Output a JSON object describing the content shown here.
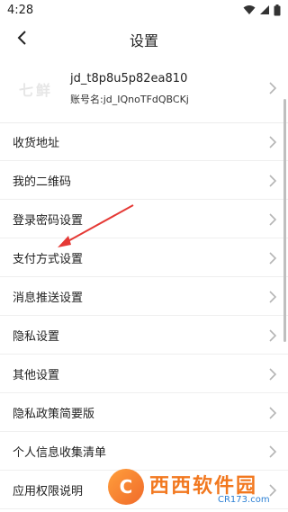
{
  "status": {
    "time": "4:28"
  },
  "header": {
    "title": "设置"
  },
  "account": {
    "logo_text": "七鲜",
    "username": "jd_t8p8u5p82ea810",
    "account_id": "账号名:jd_IQnoTFdQBCKj"
  },
  "menu": [
    {
      "label": "收货地址"
    },
    {
      "label": "我的二维码"
    },
    {
      "label": "登录密码设置"
    },
    {
      "label": "支付方式设置"
    },
    {
      "label": "消息推送设置"
    },
    {
      "label": "隐私设置"
    },
    {
      "label": "其他设置"
    },
    {
      "label": "隐私政策简要版"
    },
    {
      "label": "个人信息收集清单"
    },
    {
      "label": "应用权限说明"
    }
  ],
  "watermark": {
    "main": "西西软件园",
    "sub": "CR173.com"
  },
  "colors": {
    "annotation_arrow": "#e53935",
    "watermark_orange": "#f2781f"
  }
}
